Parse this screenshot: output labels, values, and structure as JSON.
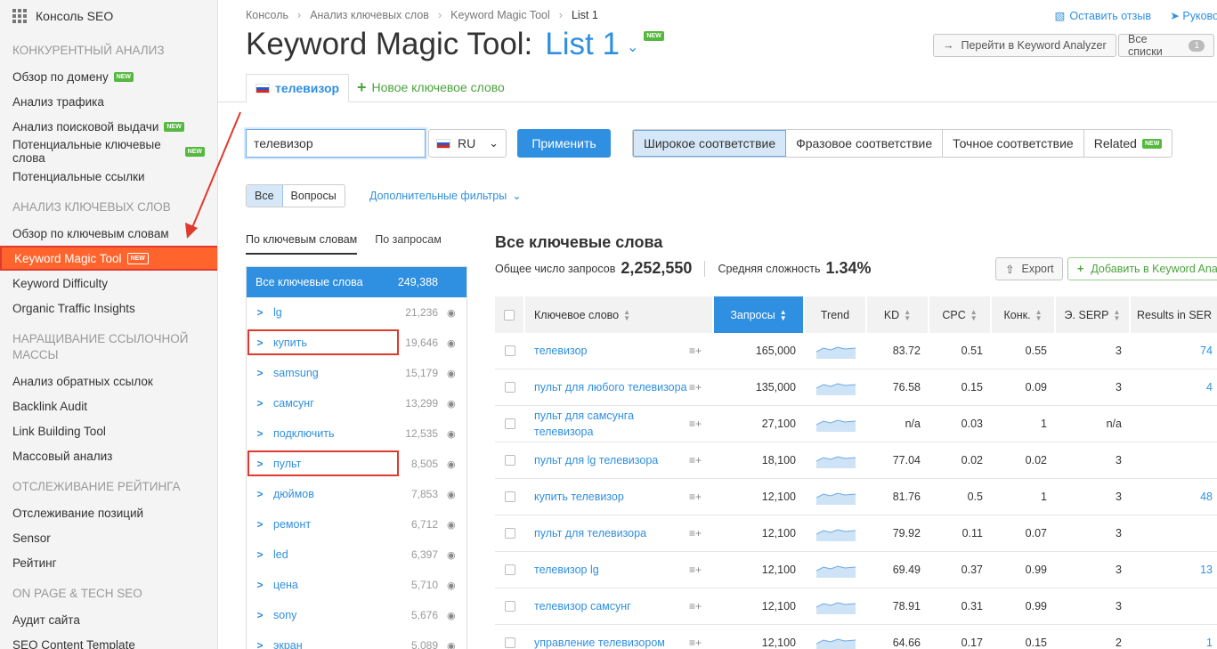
{
  "sidebar": {
    "top_label": "Консоль SEO",
    "sections": [
      {
        "title": "КОНКУРЕНТНЫЙ АНАЛИЗ",
        "items": [
          {
            "label": "Обзор по домену",
            "new": true
          },
          {
            "label": "Анализ трафика",
            "new": false
          },
          {
            "label": "Анализ поисковой выдачи",
            "new": true
          },
          {
            "label": "Потенциальные ключевые слова",
            "new": true
          },
          {
            "label": "Потенциальные ссылки",
            "new": false
          }
        ]
      },
      {
        "title": "АНАЛИЗ КЛЮЧЕВЫХ СЛОВ",
        "items": [
          {
            "label": "Обзор по ключевым словам",
            "new": false
          },
          {
            "label": "Keyword Magic Tool",
            "new": true,
            "active": true
          },
          {
            "label": "Keyword Difficulty",
            "new": false
          },
          {
            "label": "Organic Traffic Insights",
            "new": false
          }
        ]
      },
      {
        "title": "НАРАЩИВАНИЕ ССЫЛОЧНОЙ МАССЫ",
        "items": [
          {
            "label": "Анализ обратных ссылок",
            "new": false
          },
          {
            "label": "Backlink Audit",
            "new": false
          },
          {
            "label": "Link Building Tool",
            "new": false
          },
          {
            "label": "Массовый анализ",
            "new": false
          }
        ]
      },
      {
        "title": "ОТСЛЕЖИВАНИЕ РЕЙТИНГА",
        "items": [
          {
            "label": "Отслеживание позиций",
            "new": false
          },
          {
            "label": "Sensor",
            "new": false
          },
          {
            "label": "Рейтинг",
            "new": false
          }
        ]
      },
      {
        "title": "ON PAGE & TECH SEO",
        "items": [
          {
            "label": "Аудит сайта",
            "new": false
          },
          {
            "label": "SEO Content Template",
            "new": false
          }
        ]
      }
    ],
    "new_badge": "NEW"
  },
  "breadcrumb": [
    "Консоль",
    "Анализ ключевых слов",
    "Keyword Magic Tool",
    "List 1"
  ],
  "header": {
    "title": "Keyword Magic Tool:",
    "list_name": "List 1",
    "feedback": "Оставить отзыв",
    "guide": "Руково",
    "go_analyzer": "Перейти в Keyword Analyzer",
    "all_lists": "Все списки",
    "all_lists_count": "1"
  },
  "tabs": {
    "active": "телевизор",
    "new_keyword": "Новое ключевое слово"
  },
  "search": {
    "value": "телевизор",
    "db": "RU",
    "apply": "Применить"
  },
  "match": [
    "Широкое соответствие",
    "Фразовое соответствие",
    "Точное соответствие",
    "Related"
  ],
  "filters": {
    "all": "Все",
    "questions": "Вопросы",
    "more": "Дополнительные фильтры"
  },
  "group_tabs": {
    "by_keywords": "По ключевым словам",
    "by_volume": "По запросам"
  },
  "groups": {
    "head_label": "Все ключевые слова",
    "head_count": "249,388",
    "items": [
      {
        "name": "lg",
        "count": "21,236"
      },
      {
        "name": "купить",
        "count": "19,646",
        "hl": true
      },
      {
        "name": "samsung",
        "count": "15,179"
      },
      {
        "name": "самсунг",
        "count": "13,299"
      },
      {
        "name": "подключить",
        "count": "12,535"
      },
      {
        "name": "пульт",
        "count": "8,505",
        "hl": true
      },
      {
        "name": "дюймов",
        "count": "7,853"
      },
      {
        "name": "ремонт",
        "count": "6,712"
      },
      {
        "name": "led",
        "count": "6,397"
      },
      {
        "name": "цена",
        "count": "5,710"
      },
      {
        "name": "sony",
        "count": "5,676"
      },
      {
        "name": "экран",
        "count": "5,089"
      }
    ]
  },
  "results": {
    "title": "Все ключевые слова",
    "total_label": "Общее число запросов",
    "total_value": "2,252,550",
    "kd_label": "Средняя сложность",
    "kd_value": "1.34%",
    "export": "Export",
    "add_to": "Добавить в Keyword Anal"
  },
  "table": {
    "headers": [
      "Ключевое слово",
      "Запросы",
      "Trend",
      "KD",
      "CPC",
      "Конк.",
      "Э. SERP",
      "Results in SER"
    ],
    "rows": [
      {
        "kw": "телевизор",
        "vol": "165,000",
        "kd": "83.72",
        "cpc": "0.51",
        "comp": "0.55",
        "serp": "3",
        "res": "74"
      },
      {
        "kw": "пульт для любого телевизора",
        "vol": "135,000",
        "kd": "76.58",
        "cpc": "0.15",
        "comp": "0.09",
        "serp": "3",
        "res": "4"
      },
      {
        "kw": "пульт для самсунга телевизора",
        "vol": "27,100",
        "kd": "n/a",
        "cpc": "0.03",
        "comp": "1",
        "serp": "n/a",
        "res": ""
      },
      {
        "kw": "пульт для lg телевизора",
        "vol": "18,100",
        "kd": "77.04",
        "cpc": "0.02",
        "comp": "0.02",
        "serp": "3",
        "res": ""
      },
      {
        "kw": "купить телевизор",
        "vol": "12,100",
        "kd": "81.76",
        "cpc": "0.5",
        "comp": "1",
        "serp": "3",
        "res": "48"
      },
      {
        "kw": "пульт для телевизора",
        "vol": "12,100",
        "kd": "79.92",
        "cpc": "0.11",
        "comp": "0.07",
        "serp": "3",
        "res": ""
      },
      {
        "kw": "телевизор lg",
        "vol": "12,100",
        "kd": "69.49",
        "cpc": "0.37",
        "comp": "0.99",
        "serp": "3",
        "res": "13"
      },
      {
        "kw": "телевизор самсунг",
        "vol": "12,100",
        "kd": "78.91",
        "cpc": "0.31",
        "comp": "0.99",
        "serp": "3",
        "res": ""
      },
      {
        "kw": "управление телевизором",
        "vol": "12,100",
        "kd": "64.66",
        "cpc": "0.17",
        "comp": "0.15",
        "serp": "2",
        "res": "1"
      }
    ]
  },
  "colors": {
    "accent": "#2f8fe0",
    "active": "#ff642d",
    "highlight": "#e03a2e",
    "new": "#56b840"
  }
}
